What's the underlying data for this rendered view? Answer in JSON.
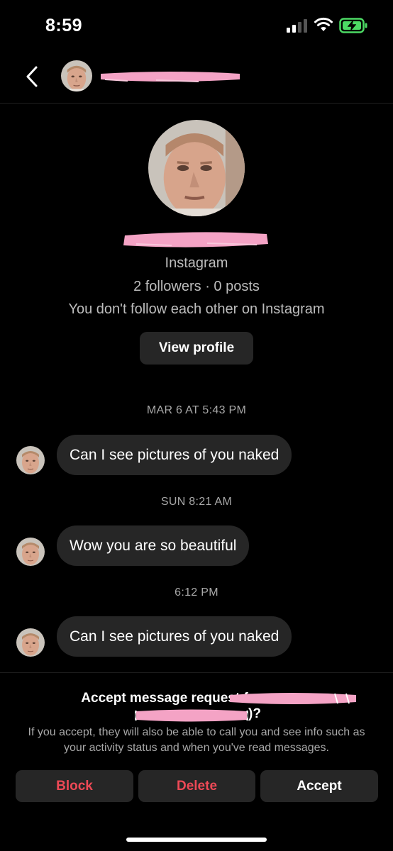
{
  "status_bar": {
    "time": "8:59",
    "signal_icon": "cellular-signal-icon",
    "wifi_icon": "wifi-icon",
    "battery_icon": "battery-charging-icon",
    "battery_color": "#4cd964"
  },
  "header": {
    "back_icon": "chevron-left-icon",
    "redaction_color": "#f4a3c5"
  },
  "profile": {
    "platform": "Instagram",
    "stats": "2 followers · 0 posts",
    "follow_status": "You don't follow each other on Instagram",
    "view_profile_label": "View profile"
  },
  "messages": [
    {
      "timestamp": "MAR 6 AT 5:43 PM",
      "text": "Can I see pictures of you naked"
    },
    {
      "timestamp": "SUN 8:21 AM",
      "text": "Wow you are so beautiful"
    },
    {
      "timestamp": "6:12 PM",
      "text": "Can I see pictures of you naked"
    }
  ],
  "request": {
    "title": "Accept message request from",
    "question_suffix": ")?",
    "info": "If you accept, they will also be able to call you and see info such as your activity status and when you've read messages.",
    "block_label": "Block",
    "delete_label": "Delete",
    "accept_label": "Accept"
  },
  "colors": {
    "background": "#000000",
    "bubble": "#262626",
    "destructive": "#ed4956",
    "secondary_text": "#a8a8a8"
  }
}
